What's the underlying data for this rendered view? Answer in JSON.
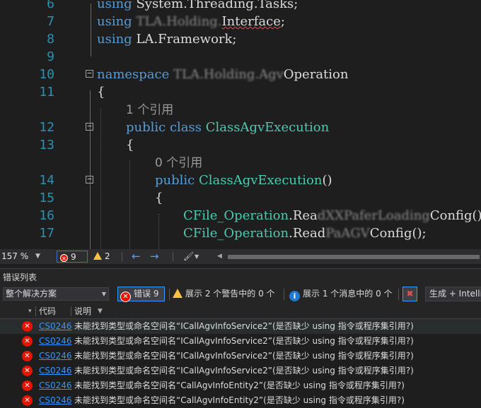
{
  "code_lines": [
    {
      "num": "6",
      "parts": [
        {
          "t": "using ",
          "c": "kw"
        },
        {
          "t": "System.Threading.Tasks;",
          "c": ""
        }
      ]
    },
    {
      "num": "7",
      "parts": [
        {
          "t": "using ",
          "c": "kw"
        },
        {
          "t": "TLA.Holding.",
          "c": "blur"
        },
        {
          "t": "Interface",
          "c": "squig"
        },
        {
          "t": ";",
          "c": ""
        }
      ]
    },
    {
      "num": "8",
      "parts": [
        {
          "t": "using ",
          "c": "kw"
        },
        {
          "t": "LA.Framework;",
          "c": ""
        }
      ]
    },
    {
      "num": "9",
      "parts": []
    },
    {
      "num": "10",
      "parts": [
        {
          "t": "namespace ",
          "c": "kw"
        },
        {
          "t": "TLA.Holding.Agv",
          "c": "blur"
        },
        {
          "t": "Operation",
          "c": ""
        }
      ]
    },
    {
      "num": "11",
      "parts": [
        {
          "t": "{",
          "c": ""
        }
      ]
    },
    {
      "num": "",
      "parts": [
        {
          "t": "1 个引用",
          "c": "ref"
        }
      ]
    },
    {
      "num": "12",
      "parts": [
        {
          "t": "public class ",
          "c": "kw"
        },
        {
          "t": "ClassAgvExecution",
          "c": "ty"
        }
      ]
    },
    {
      "num": "13",
      "parts": [
        {
          "t": "{",
          "c": ""
        }
      ]
    },
    {
      "num": "",
      "parts": [
        {
          "t": "0 个引用",
          "c": "ref"
        }
      ]
    },
    {
      "num": "14",
      "parts": [
        {
          "t": "public ",
          "c": "kw"
        },
        {
          "t": "ClassAgvExecution",
          "c": "ty"
        },
        {
          "t": "()",
          "c": ""
        }
      ]
    },
    {
      "num": "15",
      "parts": [
        {
          "t": "{",
          "c": ""
        }
      ]
    },
    {
      "num": "16",
      "parts": [
        {
          "t": "CFile_Operation",
          "c": "ty"
        },
        {
          "t": ".Rea",
          "c": ""
        },
        {
          "t": "dXXPaferLoading",
          "c": "blur"
        },
        {
          "t": "Config()",
          "c": ""
        }
      ]
    },
    {
      "num": "17",
      "parts": [
        {
          "t": "CFile_Operation",
          "c": "ty"
        },
        {
          "t": ".Read",
          "c": ""
        },
        {
          "t": "PaAGV",
          "c": "blur"
        },
        {
          "t": "Config();",
          "c": ""
        }
      ]
    }
  ],
  "status": {
    "zoom": "157 %",
    "errors": "9",
    "warnings": "2"
  },
  "panel": {
    "title": "错误列表",
    "scope": "整个解决方案",
    "errors_btn": "错误 9",
    "warnings_btn": "展示 2 个警告中的 0 个",
    "messages_btn": "展示 1 个消息中的 0 个",
    "build_filter": "生成 + IntelliSense"
  },
  "columns": {
    "code": "代码",
    "description": "说明"
  },
  "errors": [
    {
      "code": "CS0246",
      "desc": "未能找到类型或命名空间名“ICallAgvInfoService2”(是否缺少 using 指令或程序集引用?)"
    },
    {
      "code": "CS0246",
      "desc": "未能找到类型或命名空间名“ICallAgvInfoService2”(是否缺少 using 指令或程序集引用?)"
    },
    {
      "code": "CS0246",
      "desc": "未能找到类型或命名空间名“ICallAgvInfoService2”(是否缺少 using 指令或程序集引用?)"
    },
    {
      "code": "CS0246",
      "desc": "未能找到类型或命名空间名“ICallAgvInfoService2”(是否缺少 using 指令或程序集引用?)"
    },
    {
      "code": "CS0246",
      "desc": "未能找到类型或命名空间名“CallAgvInfoEntity2”(是否缺少 using 指令或程序集引用?)"
    },
    {
      "code": "CS0246",
      "desc": "未能找到类型或命名空间名“CallAgvInfoEntity2”(是否缺少 using 指令或程序集引用?)"
    }
  ]
}
